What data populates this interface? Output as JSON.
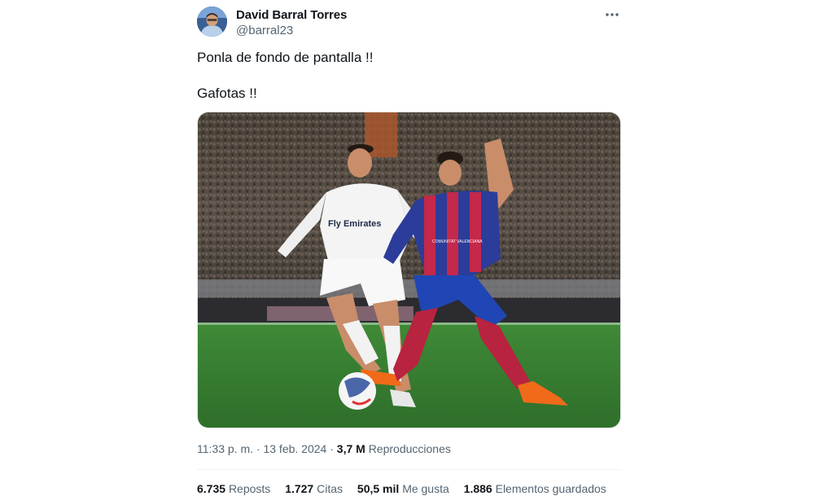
{
  "author": {
    "display_name": "David Barral Torres",
    "handle": "@barral23"
  },
  "tweet": {
    "lines": [
      "Ponla de fondo de pantalla !!",
      "Gafotas !!"
    ]
  },
  "media": {
    "kit_text_white": "Fly Emirates",
    "kit_text_blue": "COMUNITAT VALENCIANA"
  },
  "meta": {
    "time": "11:33 p. m.",
    "separator1": " · ",
    "date": "13 feb. 2024",
    "separator2": " · ",
    "views": "3,7 M",
    "views_label": "Reproducciones"
  },
  "stats": [
    {
      "num": "6.735",
      "label": "Reposts"
    },
    {
      "num": "1.727",
      "label": "Citas"
    },
    {
      "num": "50,5 mil",
      "label": "Me gusta"
    },
    {
      "num": "1.886",
      "label": "Elementos guardados"
    }
  ],
  "icons": {
    "more": "more-horizontal-icon"
  }
}
